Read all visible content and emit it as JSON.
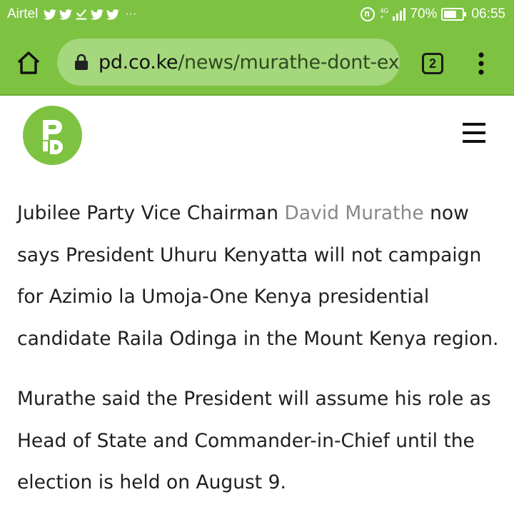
{
  "status_bar": {
    "carrier": "Airtel",
    "notification_icons": [
      "twitter-icon",
      "twitter-icon",
      "download-done-icon",
      "twitter-icon",
      "twitter-icon"
    ],
    "overflow": "···",
    "network_label_top": "4G",
    "network_label_bottom": "+",
    "battery_percent": "70%",
    "battery_level": 0.7,
    "time": "06:55"
  },
  "browser": {
    "url_domain": "pd.co.ke",
    "url_path": "/news/murathe-dont-expe",
    "tab_count": "2"
  },
  "site": {
    "logo_text": "PD"
  },
  "article": {
    "p1_before": "Jubilee Party Vice Chairman ",
    "p1_link": "David Murathe",
    "p1_after": " now says President Uhuru Kenyatta will not campaign for Azimio la Umoja-One Kenya presidential candidate Raila Odinga in the Mount Kenya region.",
    "p2": "Murathe said the President will assume his role as Head of State and Commander-in-Chief until the election is held on August 9."
  },
  "colors": {
    "brand_green": "#7dc241",
    "url_bar": "#a5d77c",
    "link_gray": "#888888",
    "text": "#1f1f1f"
  }
}
